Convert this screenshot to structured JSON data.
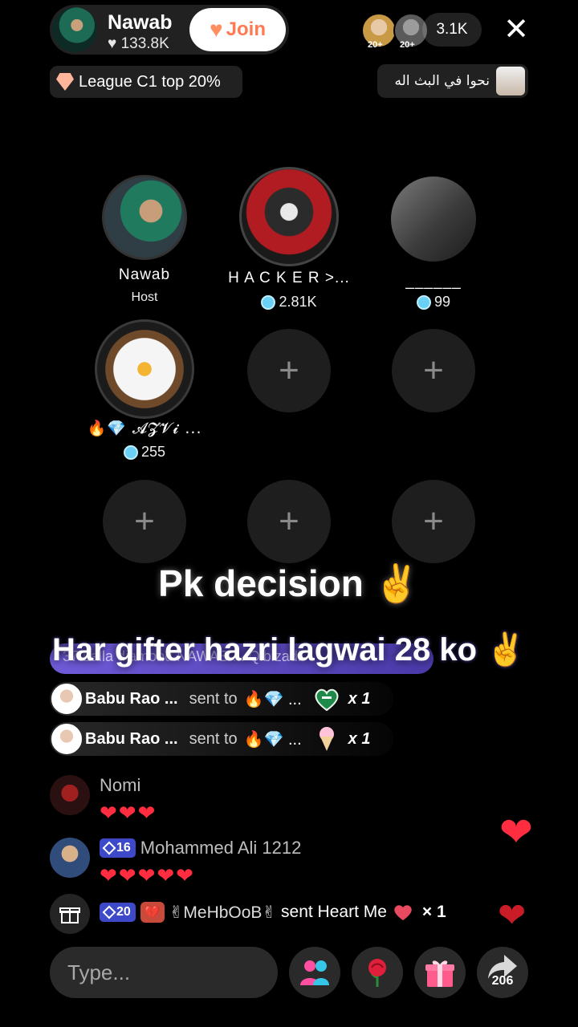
{
  "header": {
    "host_name": "Nawab",
    "host_likes": "133.8K",
    "join_label": "Join",
    "viewer_tags": [
      "20+",
      "20+"
    ],
    "viewer_count": "3.1K",
    "league_label": "League C1 top 20%",
    "arabic_banner": "نحوا في البث اله"
  },
  "seats": [
    {
      "name": "Nawab",
      "sub": "Host"
    },
    {
      "name": "H A C K E R >...",
      "score": "2.81K"
    },
    {
      "name": "______",
      "score": "99"
    },
    {
      "name": "🔥💎 𝓐𝓩𝓥𝓲 ...",
      "score": "255"
    }
  ],
  "overlay": {
    "pk_title": "Pk decision ✌️",
    "gifter_line": "Har gifter hazri lagwai 28 ko ✌️",
    "banner_text": "37  Lalla diamond  NAWAB  ...  Qibizadi"
  },
  "gift_rows": [
    {
      "sender": "Babu Rao ...",
      "sent": "sent to",
      "recipient": "🔥💎 ...",
      "count": "x 1",
      "gift_icon": "flag-heart-icon"
    },
    {
      "sender": "Babu Rao ...",
      "sent": "sent to",
      "recipient": "🔥💎 ...",
      "count": "x 1",
      "gift_icon": "ice-cream-icon"
    }
  ],
  "chat": [
    {
      "name": "Nomi",
      "hearts": "❤❤❤"
    },
    {
      "name": "Mohammed Ali 1212",
      "level": "16",
      "hearts": "❤❤❤❤❤"
    }
  ],
  "gift_notice": {
    "level": "20",
    "broken_heart": "💔",
    "name": "✌MeHbOoB✌",
    "text": "sent Heart Me",
    "count": "× 1"
  },
  "bottom_bar": {
    "placeholder": "Type...",
    "share_count": "206"
  },
  "colors": {
    "background": "#000000",
    "join_text": "#ff7a52",
    "heart": "#ff2d3f",
    "level_badge": "#3d49c9",
    "gem": "#6ad0f5"
  }
}
